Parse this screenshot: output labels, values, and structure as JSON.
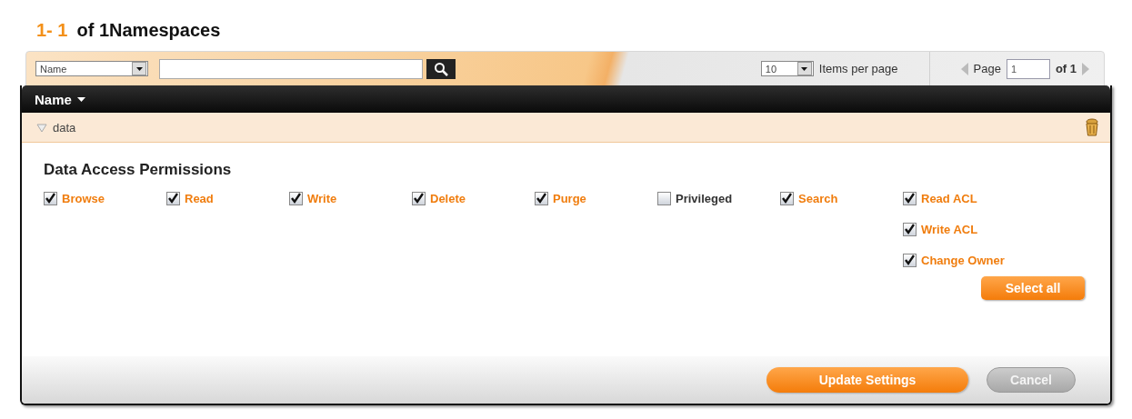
{
  "heading": {
    "range": "1- 1",
    "total": "of 1Namespaces"
  },
  "toolbar": {
    "filter_select": "Name",
    "per_page_select": "10",
    "per_page_label": "Items per page",
    "page_label": "Page",
    "page_value": "1",
    "page_total": "of 1"
  },
  "table": {
    "column": "Name",
    "row": {
      "name": "data",
      "expanded": true
    }
  },
  "permissions": {
    "title": "Data Access Permissions",
    "columns": [
      {
        "items": [
          {
            "label": "Browse",
            "checked": true
          }
        ]
      },
      {
        "items": [
          {
            "label": "Read",
            "checked": true
          }
        ]
      },
      {
        "items": [
          {
            "label": "Write",
            "checked": true
          }
        ]
      },
      {
        "items": [
          {
            "label": "Delete",
            "checked": true
          }
        ]
      },
      {
        "items": [
          {
            "label": "Purge",
            "checked": true
          }
        ]
      },
      {
        "items": [
          {
            "label": "Privileged",
            "checked": false
          }
        ]
      },
      {
        "items": [
          {
            "label": "Search",
            "checked": true
          }
        ]
      },
      {
        "items": [
          {
            "label": "Read ACL",
            "checked": true
          },
          {
            "label": "Write ACL",
            "checked": true
          },
          {
            "label": "Change Owner",
            "checked": true
          }
        ]
      }
    ],
    "select_all": "Select all"
  },
  "footer": {
    "buttons": [
      {
        "label": "Update Settings",
        "kind": "primary"
      },
      {
        "label": "Cancel",
        "kind": "secondary"
      }
    ]
  }
}
